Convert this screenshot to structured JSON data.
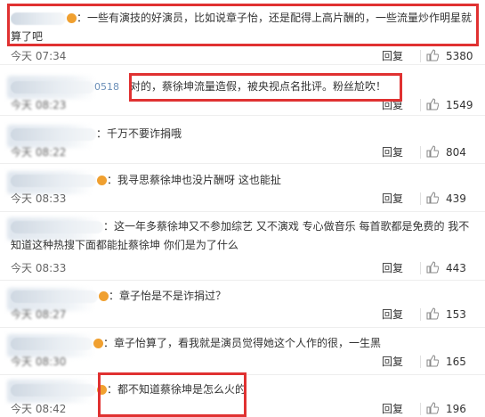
{
  "comments": [
    {
      "username_tail": "",
      "content": "：一些有演技的好演员，比如说章子怡，还是配得上高片酬的，一些流量炒作明星就算了吧",
      "time": "今天 07:34",
      "reply": "回复",
      "likes": "5380"
    },
    {
      "username_tail": "0518",
      "content": "对的，蔡徐坤流量造假，被央视点名批评。粉丝尬吹！",
      "time": "今天 08:23",
      "reply": "回复",
      "likes": "1549"
    },
    {
      "username_tail": "",
      "content": "：千万不要诈捐哦",
      "time": "今天 08:22",
      "reply": "回复",
      "likes": "804"
    },
    {
      "username_tail": "",
      "content": "：我寻思蔡徐坤也没片酬呀  这也能扯",
      "time": "今天 08:33",
      "reply": "回复",
      "likes": "439"
    },
    {
      "username_tail": "",
      "content": "：这一年多蔡徐坤又不参加综艺 又不演戏  专心做音乐   每首歌都是免费的  我不知道这种热搜下面都能扯蔡徐坤  你们是为了什么",
      "time": "今天 08:33",
      "reply": "回复",
      "likes": "443"
    },
    {
      "username_tail": "",
      "content": "：章子怡是不是诈捐过？",
      "time": "今天 08:27",
      "reply": "回复",
      "likes": "153"
    },
    {
      "username_tail": "",
      "content": "：章子怡算了，看我就是演员觉得她这个人作的很，一生黑",
      "time": "今天 08:30",
      "reply": "回复",
      "likes": "165"
    },
    {
      "username_tail": "",
      "content": "：都不知道蔡徐坤是怎么火的",
      "time": "今天 08:42",
      "reply": "回复",
      "likes": "196"
    }
  ],
  "colors": {
    "highlight_border": "#e03131",
    "text": "#333333",
    "meta": "#666666",
    "username_link": "#6b8fb8"
  },
  "icons": {
    "like": "thumbs-up-icon",
    "badge": "verified-badge-icon"
  }
}
